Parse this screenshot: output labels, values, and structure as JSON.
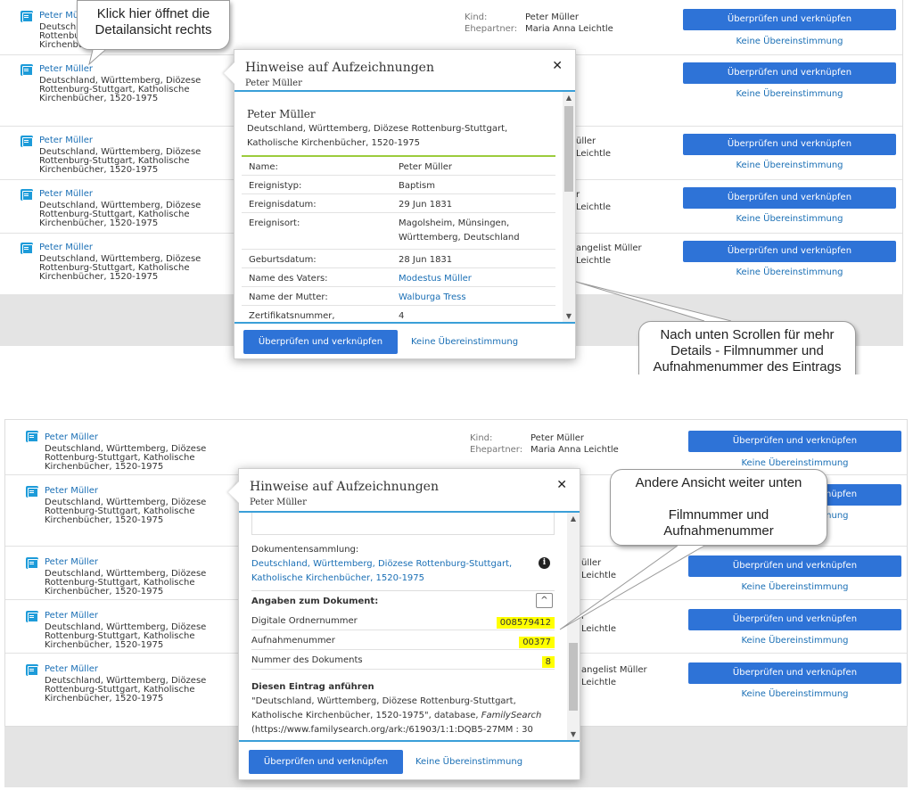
{
  "records": [
    {
      "name": "Peter Müller",
      "source": "Deutschland, Württemberg, Diözese Rottenburg-Stuttgart, Katholische Kirchenbücher, 1520-1975"
    },
    {
      "name": "Peter Müller",
      "source": "Deutschland, Württemberg, Diözese Rottenburg-Stuttgart, Katholische Kirchenbücher, 1520-1975"
    },
    {
      "name": "Peter Müller",
      "source": "Deutschland, Württemberg, Diözese Rottenburg-Stuttgart, Katholische Kirchenbücher, 1520-1975"
    },
    {
      "name": "Peter Müller",
      "source": "Deutschland, Württemberg, Diözese Rottenburg-Stuttgart, Katholische Kirchenbücher, 1520-1975"
    },
    {
      "name": "Peter Müller",
      "source": "Deutschland, Württemberg, Diözese Rottenburg-Stuttgart, Katholische Kirchenbücher, 1520-1975"
    }
  ],
  "first_record_truncated": {
    "name": "Peter Mü",
    "l1": "Deutschla",
    "l2": "Rottenbu",
    "l3": "Kirchenbü"
  },
  "relations": {
    "kind_label": "Kind:",
    "kind_value": "Peter Müller",
    "spouse_label": "Ehepartner:",
    "spouse_value": "Maria Anna Leichtle"
  },
  "right_fragments": {
    "r3a": "üller",
    "r3b": "Leichtle",
    "r4a": "r",
    "r4b": "Leichtle",
    "r5a": "angelist Müller",
    "r5b": "Leichtle"
  },
  "actions": {
    "review_link": "Überprüfen und verknüpfen",
    "no_match": "Keine Übereinstimmung"
  },
  "popup": {
    "title": "Hinweise auf Aufzeichnungen",
    "subtitle": "Peter Müller",
    "close": "✕",
    "record_name": "Peter Müller",
    "record_collection": "Deutschland, Württemberg, Diözese Rottenburg-Stuttgart, Katholische Kirchenbücher, 1520-1975",
    "details": [
      {
        "label": "Name:",
        "value": "Peter Müller",
        "link": false
      },
      {
        "label": "Ereignistyp:",
        "value": "Baptism",
        "link": false
      },
      {
        "label": "Ereignisdatum:",
        "value": "29 Jun 1831",
        "link": false
      },
      {
        "label": "Ereignisort:",
        "value": "Magolsheim, Münsingen, Württemberg, Deutschland",
        "link": false
      },
      {
        "label": "Geburtsdatum:",
        "value": "28 Jun 1831",
        "link": false
      },
      {
        "label": "Name des Vaters:",
        "value": "Modestus Müller",
        "link": true
      },
      {
        "label": "Name der Mutter:",
        "value": "Walburga Tress",
        "link": true
      },
      {
        "label": "Zertifikatsnummer,",
        "value": "4",
        "link": false
      }
    ],
    "collection_label": "Dokumentensammlung:",
    "collection_link": "Deutschland, Württemberg, Diözese Rottenburg-Stuttgart, Katholische Kirchenbücher, 1520-1975",
    "doc_section": "Angaben zum Dokument:",
    "doc_fields": [
      {
        "label": "Digitale Ordnernummer",
        "value": "008579412"
      },
      {
        "label": "Aufnahmenummer",
        "value": "00377"
      },
      {
        "label": "Nummer des Dokuments",
        "value": "8"
      }
    ],
    "cite_heading": "Diesen Eintrag anführen",
    "cite_text_1": "\"Deutschland, Württemberg, Diözese Rottenburg-Stuttgart,",
    "cite_text_2": "Katholische Kirchenbücher, 1520-1975\", database,",
    "cite_text_2b": "FamilySearch",
    "cite_text_3": "(https://www.familysearch.org/ark:/61903/1:1:DQB5-27MM : 30"
  },
  "callouts": {
    "top_left": "Klick hier öffnet die Detailansicht rechts",
    "scroll_hint": "Nach unten Scrollen für mehr Details - Filmnummer und Aufnahmenummer des Eintrags",
    "other_view_1": "Andere Ansicht weiter unten",
    "other_view_2": "Filmnummer und Aufnahmenummer"
  },
  "colors": {
    "accent": "#2e73d7",
    "link": "#1a6fb5",
    "highlight": "#ffff00",
    "rule": "#3a9fd8"
  }
}
